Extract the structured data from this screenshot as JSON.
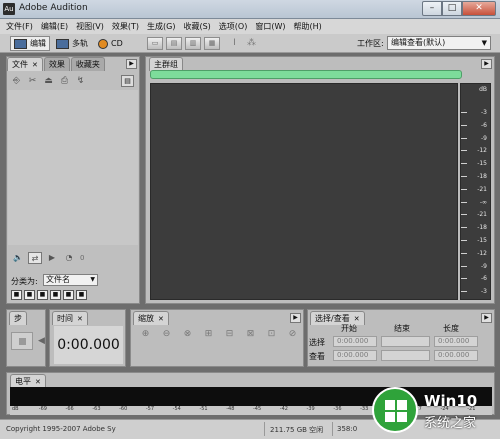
{
  "window": {
    "title": "Adobe Audition",
    "app_icon": "Au",
    "min": "–",
    "max": "□",
    "close": "✕"
  },
  "menu": [
    "文件(F)",
    "编辑(E)",
    "视图(V)",
    "效果(T)",
    "生成(G)",
    "收藏(S)",
    "选项(O)",
    "窗口(W)",
    "帮助(H)"
  ],
  "toolbar": {
    "edit_label": "编辑",
    "multitrack_label": "多轨",
    "cd_label": "CD",
    "workspace_label": "工作区:",
    "workspace_value": "编辑查看(默认)"
  },
  "file_panel": {
    "tabs": [
      "文件",
      "效果",
      "收藏夹"
    ],
    "counter": "0",
    "sort_label": "分类为:",
    "sort_value": "文件名"
  },
  "main_panel": {
    "tab": "主群组",
    "db_unit": "dB",
    "db_ticks": [
      "-3",
      "-6",
      "-9",
      "-12",
      "-15",
      "-18",
      "-21",
      "-∞",
      "-21",
      "-18",
      "-15",
      "-12",
      "-9",
      "-6",
      "-3"
    ]
  },
  "steps_panel": {
    "tab": "步"
  },
  "time_panel": {
    "tab": "时间",
    "time": "0:00.000"
  },
  "zoom_panel": {
    "tab": "缩放"
  },
  "selection_panel": {
    "tab": "选择/查看",
    "col_start": "开始",
    "col_end": "结束",
    "col_length": "长度",
    "row_selection": "选择",
    "row_view": "查看",
    "sel_start": "0:00.000",
    "sel_length": "0:00.000",
    "view_start": "0:00.000",
    "view_length": "0:00.000"
  },
  "level_panel": {
    "tab": "电平",
    "scale": [
      "dB",
      "-69",
      "-66",
      "-63",
      "-60",
      "-57",
      "-54",
      "-51",
      "-48",
      "-45",
      "-42",
      "-39",
      "-36",
      "-33",
      "-30",
      "-27",
      "-24",
      "-21"
    ]
  },
  "status": {
    "copyright": "Copyright 1995-2007 Adobe Sy",
    "disk": "211.75 GB 空闲",
    "time": "358:0"
  },
  "watermark": {
    "line1": "Win10",
    "line2": "系统之家"
  }
}
